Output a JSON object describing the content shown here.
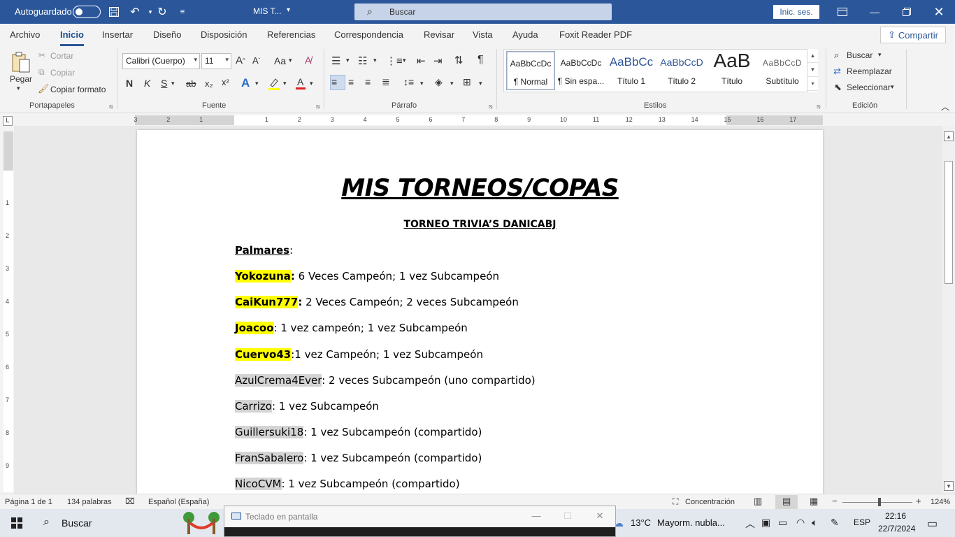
{
  "titlebar": {
    "autosave_label": "Autoguardado",
    "doc_title": "MIS T...",
    "search_placeholder": "Buscar",
    "signin_label": "Inic. ses."
  },
  "tabs": [
    "Archivo",
    "Inicio",
    "Insertar",
    "Diseño",
    "Disposición",
    "Referencias",
    "Correspondencia",
    "Revisar",
    "Vista",
    "Ayuda",
    "Foxit Reader PDF"
  ],
  "active_tab": "Inicio",
  "share_label": "Compartir",
  "ribbon": {
    "clipboard": {
      "paste": "Pegar",
      "cut": "Cortar",
      "copy": "Copiar",
      "format_painter": "Copiar formato",
      "label": "Portapapeles"
    },
    "font": {
      "family": "Calibri (Cuerpo)",
      "size": "11",
      "bold": "N",
      "italic": "K",
      "underline": "S",
      "strike": "ab",
      "subscript": "x₂",
      "superscript": "x²",
      "change_case": "Aa",
      "label": "Fuente"
    },
    "paragraph": {
      "label": "Párrafo"
    },
    "styles": {
      "items": [
        {
          "sample": "AaBbCcDc",
          "name": "¶ Normal"
        },
        {
          "sample": "AaBbCcDc",
          "name": "¶ Sin espa..."
        },
        {
          "sample": "AaBbCc",
          "name": "Título 1"
        },
        {
          "sample": "AaBbCcD",
          "name": "Título 2"
        },
        {
          "sample": "AaB",
          "name": "Título"
        },
        {
          "sample": "AaBbCcD",
          "name": "Subtítulo"
        }
      ],
      "label": "Estilos"
    },
    "editing": {
      "find": "Buscar",
      "replace": "Reemplazar",
      "select": "Seleccionar",
      "label": "Edición"
    }
  },
  "document": {
    "title": "MIS TORNEOS/COPAS",
    "subtitle": "TORNEO TRIVIA’S DANICABJ",
    "heading": "Palmares",
    "heading_suffix": ":",
    "entries": [
      {
        "name": "Yokozuna",
        "sep": ":",
        "text": " 6 Veces Campeón; 1 vez Subcampeón"
      },
      {
        "name": "CaiKun777",
        "sep": ":",
        "text": " 2 Veces Campeón; 2 veces Subcampeón"
      },
      {
        "name": "Joacoo",
        "sep": ":",
        "text": " 1 vez campeón; 1 vez Subcampeón"
      },
      {
        "name": "Cuervo43",
        "sep": ":",
        "text": "1 vez Campeón; 1 vez Subcampeón"
      },
      {
        "name": "AzulCrema4Ever",
        "sep": ":",
        "text": " 2 veces Subcampeón (uno compartido)"
      },
      {
        "name": "Carrizo",
        "sep": ":",
        "text": " 1 vez Subcampeón"
      },
      {
        "name": "Guillersuki18",
        "sep": ":",
        "text": " 1 vez Subcampeón (compartido)"
      },
      {
        "name": "FranSabalero",
        "sep": ":",
        "text": " 1 vez Subcampeón (compartido)"
      },
      {
        "name": "NicoCVM",
        "sep": ":",
        "text": " 1 vez Subcampeón (compartido)"
      }
    ]
  },
  "statusbar": {
    "page": "Página 1 de 1",
    "words": "134 palabras",
    "language": "Español (España)",
    "focus": "Concentración",
    "zoom": "124%"
  },
  "osk": {
    "title": "Teclado en pantalla"
  },
  "taskbar": {
    "search": "Buscar",
    "weather_temp": "13°C",
    "weather_desc": "Mayorm. nubla...",
    "lang": "ESP",
    "time": "22:16",
    "date": "22/7/2024"
  },
  "colors": {
    "titlebar": "#2b579a",
    "highlight_yellow": "#ffff00",
    "highlight_gray": "#d4d4d4"
  }
}
